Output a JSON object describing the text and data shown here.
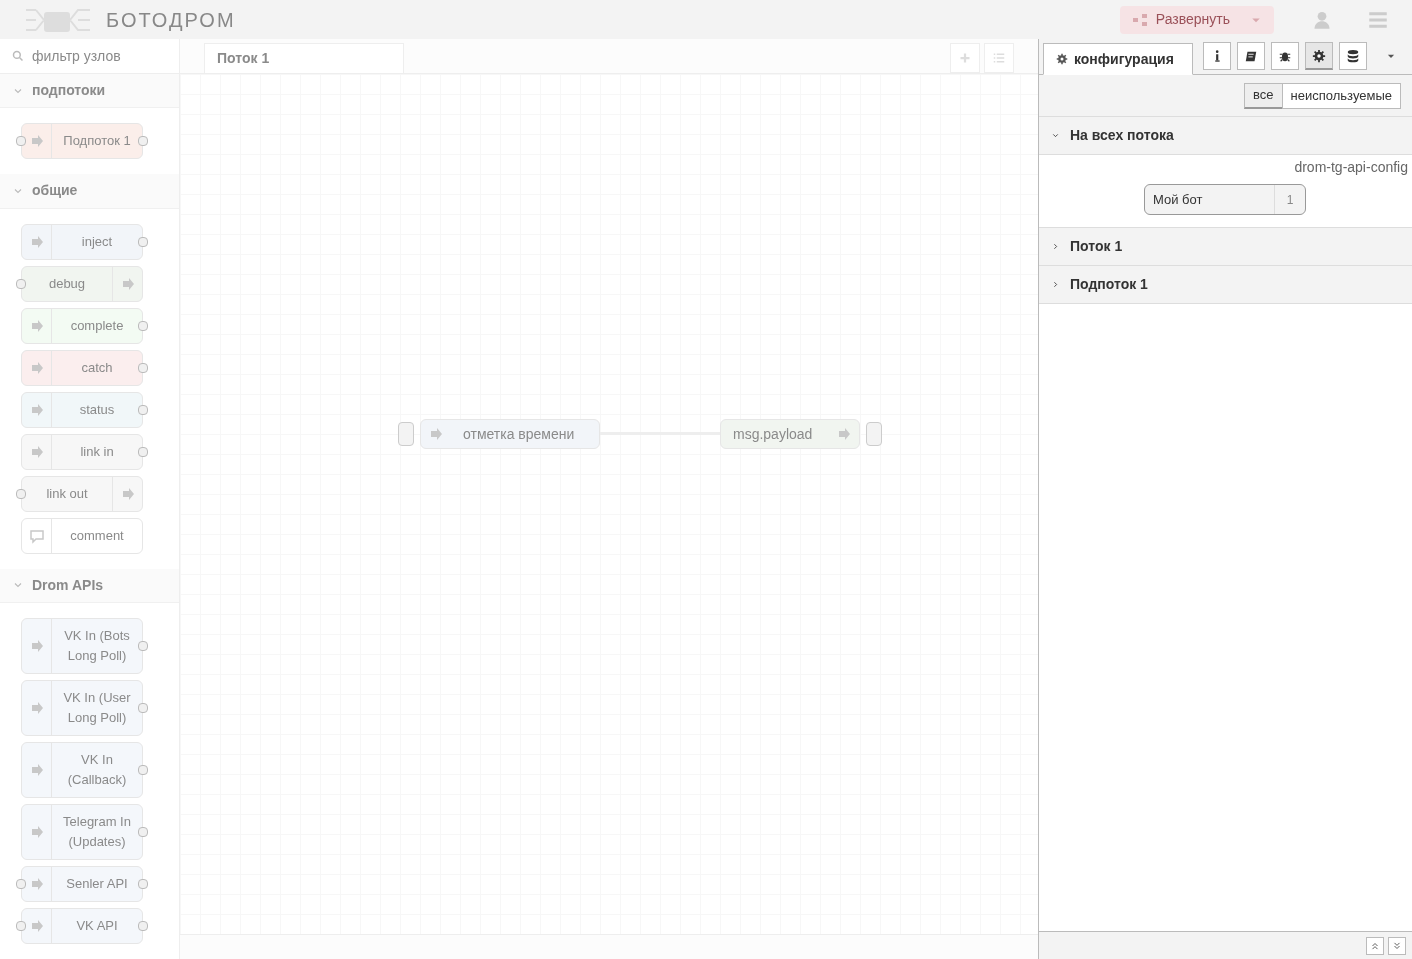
{
  "header": {
    "logo_text": "БОТОДРОМ",
    "deploy_button": "Развернуть"
  },
  "palette": {
    "filter_placeholder": "фильтр узлов",
    "categories": [
      {
        "label": "подпотоки",
        "expanded": true,
        "nodes": [
          {
            "label": "Подпоток 1",
            "kind": "process",
            "color": "#fbeeea"
          }
        ]
      },
      {
        "label": "общие",
        "expanded": true,
        "nodes": [
          {
            "label": "inject",
            "kind": "source",
            "color": "#f2f5f9"
          },
          {
            "label": "debug",
            "kind": "sink",
            "color": "#f1f5f0"
          },
          {
            "label": "complete",
            "kind": "source",
            "color": "#f3fbf3"
          },
          {
            "label": "catch",
            "kind": "source",
            "color": "#fbeeee"
          },
          {
            "label": "status",
            "kind": "source",
            "color": "#f1f7f9"
          },
          {
            "label": "link in",
            "kind": "source",
            "color": "#f7f7f7"
          },
          {
            "label": "link out",
            "kind": "sink",
            "color": "#f7f7f7"
          },
          {
            "label": "comment",
            "kind": "note",
            "color": "#ffffff"
          }
        ]
      },
      {
        "label": "Drom APIs",
        "expanded": true,
        "nodes": [
          {
            "label": "VK In (Bots Long Poll)",
            "kind": "source",
            "color": "#f4f7fb"
          },
          {
            "label": "VK In (User Long Poll)",
            "kind": "source",
            "color": "#f4f7fb"
          },
          {
            "label": "VK In (Callback)",
            "kind": "source",
            "color": "#f4f7fb"
          },
          {
            "label": "Telegram In (Updates)",
            "kind": "source",
            "color": "#f4f7fb"
          },
          {
            "label": "Senler API",
            "kind": "process",
            "color": "#f4f7fb"
          },
          {
            "label": "VK API",
            "kind": "process",
            "color": "#f4f7fb"
          }
        ]
      }
    ]
  },
  "workspace": {
    "tabs": [
      {
        "label": "Поток 1",
        "selected": true
      }
    ],
    "nodes": [
      {
        "label": "отметка времени",
        "kind": "source",
        "color": "#f2f5f9"
      },
      {
        "label": "msg.payload",
        "kind": "sink",
        "color": "#f1f5f0"
      }
    ]
  },
  "sidebar": {
    "tabs": [
      {
        "label": "конфигурация",
        "selected": true
      }
    ],
    "tab_buttons": [
      {
        "kind": "info",
        "selected": false
      },
      {
        "kind": "help",
        "selected": false
      },
      {
        "kind": "debug",
        "selected": false
      },
      {
        "kind": "config",
        "selected": true
      },
      {
        "kind": "context",
        "selected": false
      }
    ],
    "filters": [
      {
        "label": "все",
        "selected": true
      },
      {
        "label": "неиспользуемые",
        "selected": false
      }
    ],
    "sections": [
      {
        "label": "На всех потока",
        "expanded": true,
        "type_label": "drom-tg-api-config",
        "nodes": [
          {
            "label": "Мой бот",
            "count": "1"
          }
        ]
      },
      {
        "label": "Поток 1",
        "expanded": false
      },
      {
        "label": "Подпоток 1",
        "expanded": false
      }
    ]
  }
}
